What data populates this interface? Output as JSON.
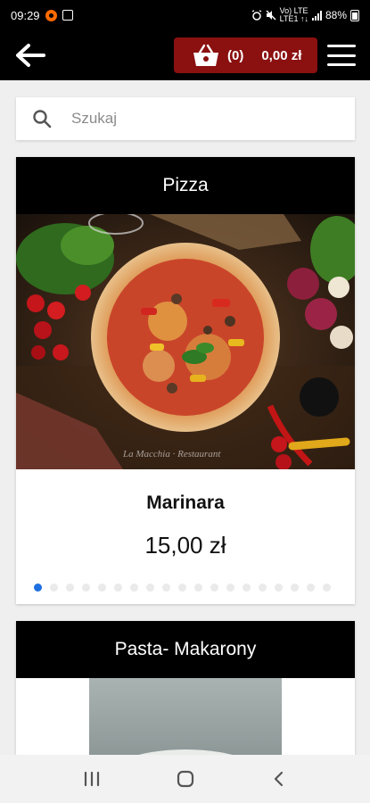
{
  "status_bar": {
    "time": "09:29",
    "net_top": "Vo) LTE",
    "net_bottom": "LTE1 ↑↓",
    "battery": "88%"
  },
  "header": {
    "cart_count": "(0)",
    "cart_total": "0,00 zł"
  },
  "search": {
    "placeholder": "Szukaj"
  },
  "categories": [
    {
      "title": "Pizza",
      "item_name": "Marinara",
      "item_price": "15,00 zł",
      "carousel": {
        "slide_count": 19,
        "active_index": 0
      },
      "watermark": "La Macchia · Restaurant"
    },
    {
      "title": "Pasta- Makarony"
    }
  ],
  "colors": {
    "cart_button": "#8b1010",
    "header_bg": "#000000",
    "active_dot": "#1e6fe0"
  },
  "icons": [
    "back-arrow-icon",
    "basket-icon",
    "hamburger-menu-icon",
    "search-icon",
    "recents-icon",
    "home-icon",
    "back-nav-icon"
  ]
}
